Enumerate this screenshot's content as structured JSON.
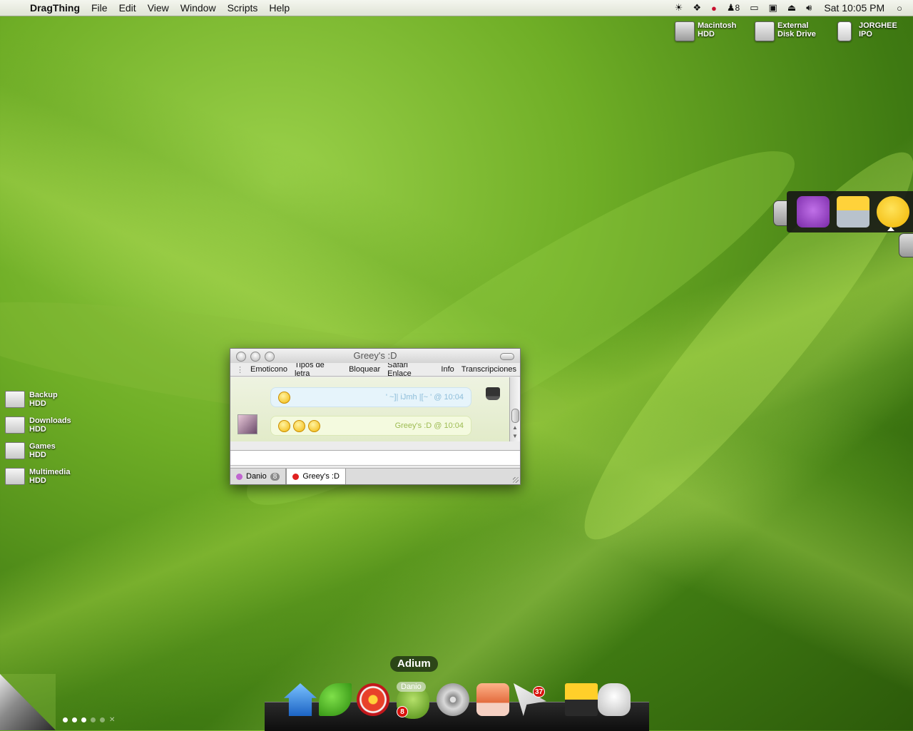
{
  "menubar": {
    "app_name": "DragThing",
    "menus": [
      "File",
      "Edit",
      "View",
      "Window",
      "Scripts",
      "Help"
    ],
    "status_icons": [
      "sun-icon",
      "dropbox-icon",
      "pinterest-icon",
      "user-icon",
      "display-icon",
      "info-icon",
      "eject-icon",
      "volume-icon"
    ],
    "user_count": "8",
    "clock": "Sat 10:05 PM"
  },
  "drives": [
    {
      "line1": "Macintosh",
      "line2": "HDD"
    },
    {
      "line1": "External",
      "line2": "Disk Drive"
    },
    {
      "line1": "JORGHEE",
      "line2": "IPO"
    }
  ],
  "desktop_items": [
    {
      "line1": "Backup",
      "line2": "HDD"
    },
    {
      "line1": "Downloads",
      "line2": "HDD"
    },
    {
      "line1": "Games",
      "line2": "HDD"
    },
    {
      "line1": "Multimedia",
      "line2": "HDD"
    }
  ],
  "chat_window": {
    "title": "Greey's :D",
    "toolbar": [
      "Emoticono",
      "Tipos de letra",
      "Bloquear",
      "Safari Enlace",
      "Info",
      "Transcripciones"
    ],
    "messages": [
      {
        "meta": "' ~]| iJmh |[~ ' @ 10:04"
      },
      {
        "meta": "Greey's :D @ 10:04"
      }
    ],
    "tabs": [
      {
        "name": "Danio",
        "count": "8",
        "color": "#c065d0"
      },
      {
        "name": "Greey's :D",
        "color": "#e02020"
      }
    ]
  },
  "dock": {
    "tooltip": "Adium",
    "tooltip_sub": "Danio",
    "adium_badge": "8",
    "mail_badge": "37",
    "items": [
      "home-icon",
      "leaf-icon",
      "itunes-icon",
      "adium-icon",
      "dvd-icon",
      "cake-icon",
      "mail-icon",
      "film-icon",
      "ghost-icon"
    ]
  },
  "colors": {
    "accent_badge": "#d8130d",
    "desktop_green": "#6fae26"
  }
}
